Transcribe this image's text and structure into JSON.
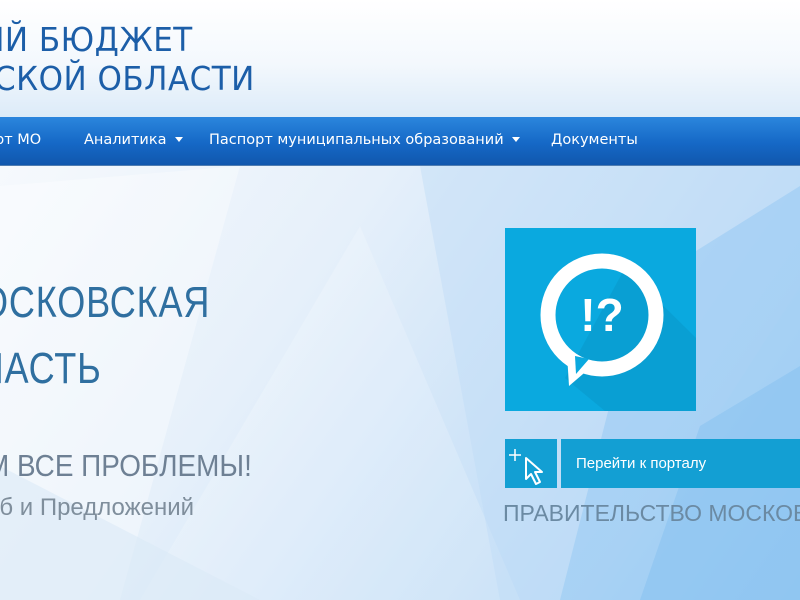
{
  "header": {
    "title_line1": "ЫЙ БЮДЖЕТ",
    "title_line2": "СКОЙ ОБЛАСТИ"
  },
  "nav": {
    "items": [
      {
        "label": "рт МО",
        "has_dropdown": false
      },
      {
        "label": "Аналитика",
        "has_dropdown": true
      },
      {
        "label": "Паспорт муниципальных образований",
        "has_dropdown": true
      },
      {
        "label": "Документы",
        "has_dropdown": false
      }
    ]
  },
  "hero": {
    "heading_line1": "ОСКОВСКАЯ",
    "heading_line2": "ЛАСТЬ",
    "slogan": "М ВСЕ ПРОБЛЕМЫ!",
    "subtitle": "об и Предложений"
  },
  "portal": {
    "tile_icon": "speech-bubble-question-icon",
    "tile_text": "!?",
    "button_icon": "cursor-click-icon",
    "button_label": "Перейти к порталу",
    "caption": "ПРАВИТЕЛЬСТВО МОСКОВ"
  },
  "colors": {
    "title": "#1c5ea8",
    "nav": "#1568c6",
    "tile": "#0aa9df",
    "button": "#139fd3",
    "hero_text": "#2f6fa0",
    "slogan_text": "#6e8094"
  }
}
